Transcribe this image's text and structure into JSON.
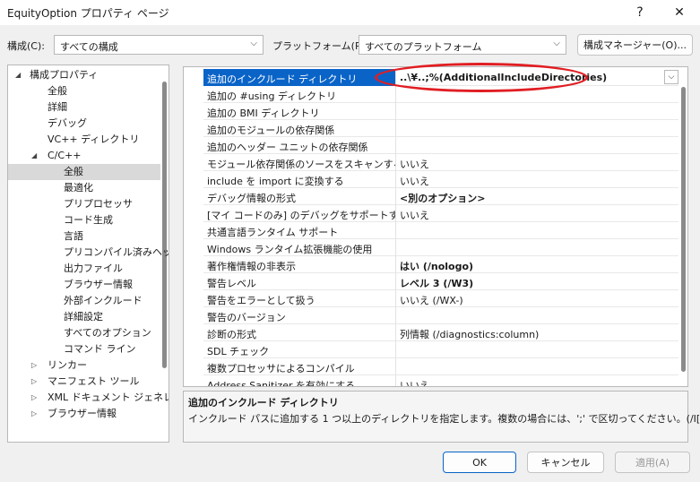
{
  "window": {
    "title": "EquityOption プロパティ ページ",
    "help_label": "?",
    "close_label": "✕"
  },
  "config": {
    "config_label": "構成(C):",
    "config_value": "すべての構成",
    "platform_label": "プラットフォーム(P):",
    "platform_value": "すべてのプラットフォーム",
    "manager_button": "構成マネージャー(O)..."
  },
  "tree": [
    {
      "label": "構成プロパティ",
      "expander": "◢",
      "level": 0
    },
    {
      "label": "全般",
      "expander": "",
      "level": 1
    },
    {
      "label": "詳細",
      "expander": "",
      "level": 1
    },
    {
      "label": "デバッグ",
      "expander": "",
      "level": 1
    },
    {
      "label": "VC++ ディレクトリ",
      "expander": "",
      "level": 1
    },
    {
      "label": "C/C++",
      "expander": "◢",
      "level": 1
    },
    {
      "label": "全般",
      "expander": "",
      "level": 2,
      "selected": true
    },
    {
      "label": "最適化",
      "expander": "",
      "level": 2
    },
    {
      "label": "プリプロセッサ",
      "expander": "",
      "level": 2
    },
    {
      "label": "コード生成",
      "expander": "",
      "level": 2
    },
    {
      "label": "言語",
      "expander": "",
      "level": 2
    },
    {
      "label": "プリコンパイル済みヘッ",
      "expander": "",
      "level": 2
    },
    {
      "label": "出力ファイル",
      "expander": "",
      "level": 2
    },
    {
      "label": "ブラウザー情報",
      "expander": "",
      "level": 2
    },
    {
      "label": "外部インクルード",
      "expander": "",
      "level": 2
    },
    {
      "label": "詳細設定",
      "expander": "",
      "level": 2
    },
    {
      "label": "すべてのオプション",
      "expander": "",
      "level": 2
    },
    {
      "label": "コマンド ライン",
      "expander": "",
      "level": 2
    },
    {
      "label": "リンカー",
      "expander": "▷",
      "level": 1
    },
    {
      "label": "マニフェスト ツール",
      "expander": "▷",
      "level": 1
    },
    {
      "label": "XML ドキュメント ジェネレー",
      "expander": "▷",
      "level": 1
    },
    {
      "label": "ブラウザー情報",
      "expander": "▷",
      "level": 1
    }
  ],
  "properties": [
    {
      "name": "追加のインクルード ディレクトリ",
      "value": "..\\¥..;%(AdditionalIncludeDirectories)",
      "selected": true,
      "bold": true
    },
    {
      "name": "追加の #using ディレクトリ",
      "value": ""
    },
    {
      "name": "追加の BMI ディレクトリ",
      "value": ""
    },
    {
      "name": "追加のモジュールの依存関係",
      "value": ""
    },
    {
      "name": "追加のヘッダー ユニットの依存関係",
      "value": ""
    },
    {
      "name": "モジュール依存関係のソースをスキャンする",
      "value": "いいえ"
    },
    {
      "name": "include を import に変換する",
      "value": "いいえ"
    },
    {
      "name": "デバッグ情報の形式",
      "value": "<別のオプション>",
      "bold": true
    },
    {
      "name": "[マイ コードのみ] のデバッグをサポートする",
      "value": "いいえ"
    },
    {
      "name": "共通言語ランタイム サポート",
      "value": ""
    },
    {
      "name": "Windows ランタイム拡張機能の使用",
      "value": ""
    },
    {
      "name": "著作権情報の非表示",
      "value": "はい (/nologo)",
      "bold": true
    },
    {
      "name": "警告レベル",
      "value": "レベル 3 (/W3)",
      "bold": true
    },
    {
      "name": "警告をエラーとして扱う",
      "value": "いいえ (/WX-)"
    },
    {
      "name": "警告のバージョン",
      "value": ""
    },
    {
      "name": "診断の形式",
      "value": "列情報 (/diagnostics:column)"
    },
    {
      "name": "SDL チェック",
      "value": ""
    },
    {
      "name": "複数プロセッサによるコンパイル",
      "value": ""
    },
    {
      "name": "Address Sanitizer を有効にする",
      "value": "いいえ"
    }
  ],
  "description": {
    "title": "追加のインクルード ディレクトリ",
    "text": "インクルード パスに追加する 1 つ以上のディレクトリを指定します。複数の場合には、';' で区切ってください。(/I[path])"
  },
  "buttons": {
    "ok": "OK",
    "cancel": "キャンセル",
    "apply": "適用(A)"
  },
  "colors": {
    "selection": "#0a64c8",
    "annotation": "#e01e23"
  }
}
